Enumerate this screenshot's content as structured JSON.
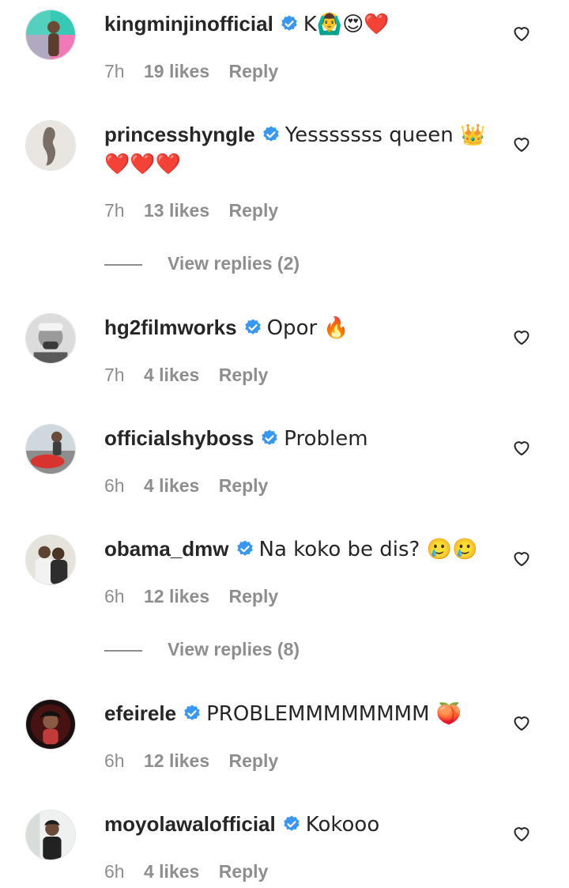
{
  "comments": [
    {
      "username": "kingminjinofficial",
      "text": "K🙆‍♂️😍❤️",
      "time": "7h",
      "likes": "19 likes",
      "reply": "Reply"
    },
    {
      "username": "princesshyngle",
      "text": "Yesssssss queen 👑 ❤️❤️❤️",
      "time": "7h",
      "likes": "13 likes",
      "reply": "Reply"
    },
    {
      "username": "hg2filmworks",
      "text": "Opor 🔥",
      "time": "7h",
      "likes": "4 likes",
      "reply": "Reply"
    },
    {
      "username": "officialshyboss",
      "text": "Problem",
      "time": "6h",
      "likes": "4 likes",
      "reply": "Reply"
    },
    {
      "username": "obama_dmw",
      "text": "Na koko be dis? 🥲🥲",
      "time": "6h",
      "likes": "12 likes",
      "reply": "Reply"
    },
    {
      "username": "efeirele",
      "text": "PROBLEMMMMMMMM 🍑",
      "time": "6h",
      "likes": "12 likes",
      "reply": "Reply"
    },
    {
      "username": "moyolawalofficial",
      "text": "Kokooo",
      "time": "6h",
      "likes": "4 likes",
      "reply": "Reply"
    }
  ],
  "view_replies": [
    {
      "label": "View replies (2)"
    },
    {
      "label": "View replies (8)"
    }
  ],
  "icons": {
    "verified": "verified-badge-icon",
    "like": "heart-outline-icon"
  },
  "colors": {
    "verified": "#3897f0",
    "muted": "#8e8e8e",
    "text": "#262626"
  }
}
